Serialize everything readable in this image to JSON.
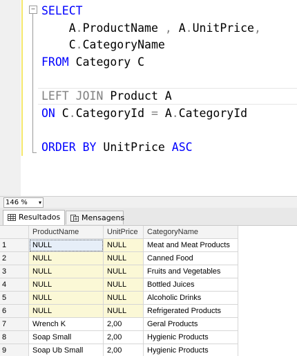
{
  "editor": {
    "collapse_glyph": "−",
    "lines": [
      [
        {
          "t": "SELECT",
          "c": "kw"
        }
      ],
      [
        {
          "t": "    A",
          "c": ""
        },
        {
          "t": ".",
          "c": "grey"
        },
        {
          "t": "ProductName ",
          "c": ""
        },
        {
          "t": ",",
          "c": "grey"
        },
        {
          "t": " A",
          "c": ""
        },
        {
          "t": ".",
          "c": "grey"
        },
        {
          "t": "UnitPrice",
          "c": ""
        },
        {
          "t": ",",
          "c": "grey"
        }
      ],
      [
        {
          "t": "    C",
          "c": ""
        },
        {
          "t": ".",
          "c": "grey"
        },
        {
          "t": "CategoryName",
          "c": ""
        }
      ],
      [
        {
          "t": "FROM",
          "c": "kw"
        },
        {
          "t": " Category C",
          "c": ""
        }
      ],
      [],
      [
        {
          "t": "LEFT JOIN",
          "c": "grey"
        },
        {
          "t": " Product A",
          "c": ""
        }
      ],
      [
        {
          "t": "ON",
          "c": "kw"
        },
        {
          "t": " C",
          "c": ""
        },
        {
          "t": ".",
          "c": "grey"
        },
        {
          "t": "CategoryId ",
          "c": ""
        },
        {
          "t": "=",
          "c": "grey"
        },
        {
          "t": " A",
          "c": ""
        },
        {
          "t": ".",
          "c": "grey"
        },
        {
          "t": "CategoryId",
          "c": ""
        }
      ],
      [],
      [
        {
          "t": "ORDER BY",
          "c": "kw"
        },
        {
          "t": " UnitPrice ",
          "c": ""
        },
        {
          "t": "ASC",
          "c": "kw"
        }
      ]
    ]
  },
  "zoom": {
    "value": "146 %",
    "arrow": "▾"
  },
  "tabs": {
    "results_label": "Resultados",
    "messages_label": "Mensagens"
  },
  "grid": {
    "columns": [
      "",
      "ProductName",
      "UnitPrice",
      "CategoryName"
    ],
    "rows": [
      [
        "1",
        "NULL",
        "NULL",
        "Meat and Meat Products"
      ],
      [
        "2",
        "NULL",
        "NULL",
        "Canned Food"
      ],
      [
        "3",
        "NULL",
        "NULL",
        "Fruits and Vegetables"
      ],
      [
        "4",
        "NULL",
        "NULL",
        "Bottled Juices"
      ],
      [
        "5",
        "NULL",
        "NULL",
        "Alcoholic Drinks"
      ],
      [
        "6",
        "NULL",
        "NULL",
        "Refrigerated Products"
      ],
      [
        "7",
        "Wrench K",
        "2,00",
        "Geral Products"
      ],
      [
        "8",
        "Soap Small",
        "2,00",
        "Hygienic Products"
      ],
      [
        "9",
        "Soap Ub Small",
        "2,00",
        "Hygienic Products"
      ]
    ],
    "null_highlight_color": "#fbf8d6"
  }
}
